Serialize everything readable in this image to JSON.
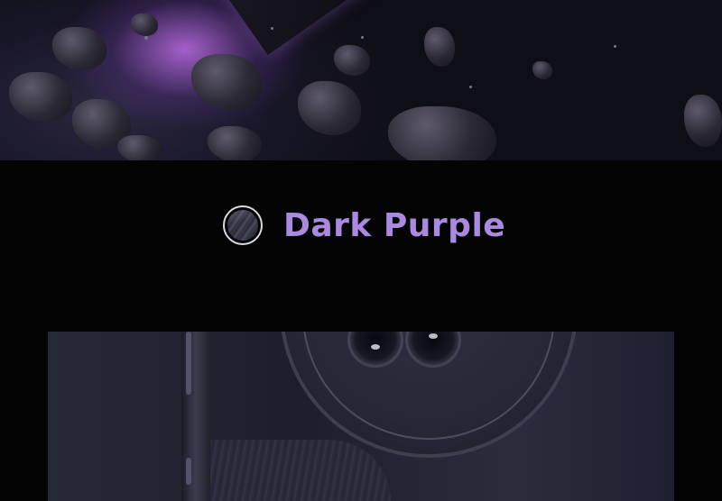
{
  "variant": {
    "color_name": "Dark Purple",
    "color_name_hex": "#a98ae0",
    "swatch_icon": "dark-purple-swatch"
  },
  "colors": {
    "background": "#040405",
    "hero_glow": "#d278ff",
    "product_body": "#262937"
  }
}
